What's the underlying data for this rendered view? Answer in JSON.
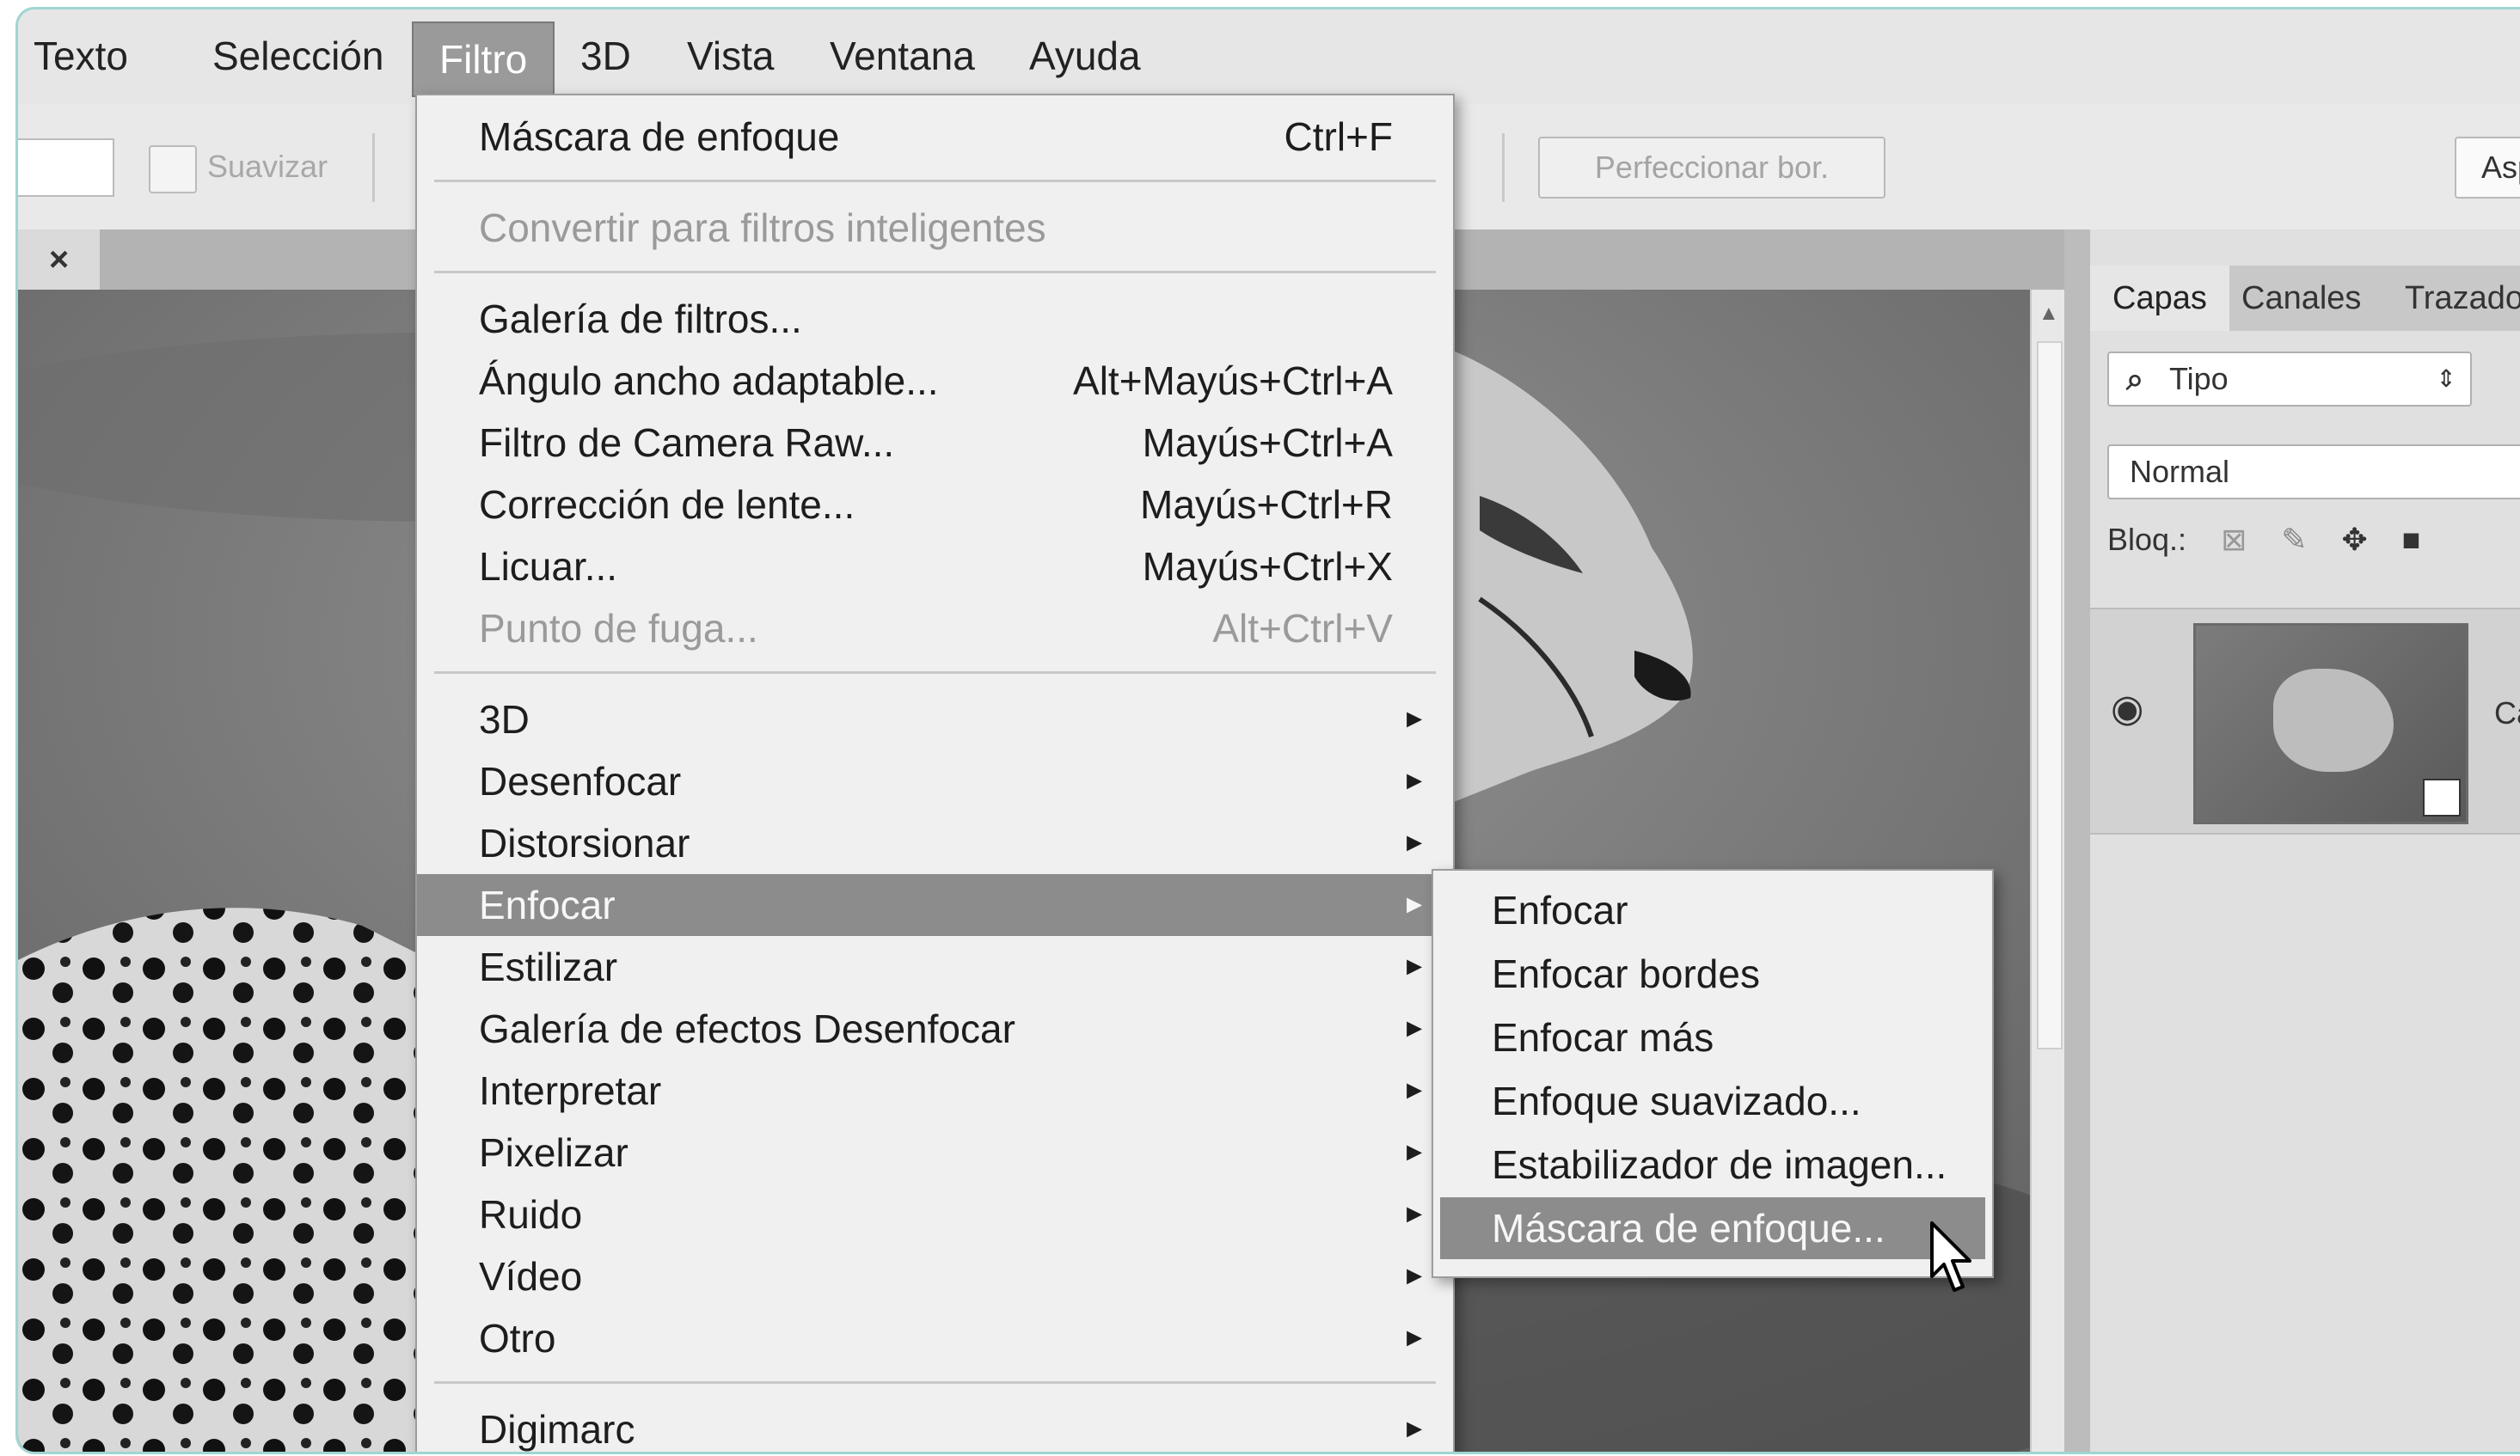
{
  "menubar": {
    "items": [
      "Texto",
      "Selección",
      "Filtro",
      "3D",
      "Vista",
      "Ventana",
      "Ayuda"
    ],
    "active": "Filtro"
  },
  "options": {
    "suavizar_label": "Suavizar",
    "refine_button": "Perfeccionar bor.",
    "truncated_button": "Asp"
  },
  "document": {
    "close_glyph": "×"
  },
  "filter_menu": {
    "items": [
      {
        "label": "Máscara de enfoque",
        "shortcut": "Ctrl+F",
        "state": "normal"
      },
      {
        "label": "Convertir para filtros inteligentes",
        "shortcut": "",
        "state": "disabled"
      },
      {
        "label": "Galería de filtros...",
        "shortcut": "",
        "state": "normal"
      },
      {
        "label": "Ángulo ancho adaptable...",
        "shortcut": "Alt+Mayús+Ctrl+A",
        "state": "normal"
      },
      {
        "label": "Filtro de Camera Raw...",
        "shortcut": "Mayús+Ctrl+A",
        "state": "normal"
      },
      {
        "label": "Corrección de lente...",
        "shortcut": "Mayús+Ctrl+R",
        "state": "normal"
      },
      {
        "label": "Licuar...",
        "shortcut": "Mayús+Ctrl+X",
        "state": "normal"
      },
      {
        "label": "Punto de fuga...",
        "shortcut": "Alt+Ctrl+V",
        "state": "disabled"
      },
      {
        "label": "3D",
        "submenu": true,
        "state": "normal"
      },
      {
        "label": "Desenfocar",
        "submenu": true,
        "state": "normal"
      },
      {
        "label": "Distorsionar",
        "submenu": true,
        "state": "normal"
      },
      {
        "label": "Enfocar",
        "submenu": true,
        "state": "highlighted"
      },
      {
        "label": "Estilizar",
        "submenu": true,
        "state": "normal"
      },
      {
        "label": "Galería de efectos Desenfocar",
        "submenu": true,
        "state": "normal"
      },
      {
        "label": "Interpretar",
        "submenu": true,
        "state": "normal"
      },
      {
        "label": "Pixelizar",
        "submenu": true,
        "state": "normal"
      },
      {
        "label": "Ruido",
        "submenu": true,
        "state": "normal"
      },
      {
        "label": "Vídeo",
        "submenu": true,
        "state": "normal"
      },
      {
        "label": "Otro",
        "submenu": true,
        "state": "normal"
      },
      {
        "label": "Digimarc",
        "submenu": true,
        "state": "normal"
      }
    ],
    "submenu_arrow": "►"
  },
  "enfocar_submenu": {
    "items": [
      {
        "label": "Enfocar",
        "state": "normal"
      },
      {
        "label": "Enfocar bordes",
        "state": "normal"
      },
      {
        "label": "Enfocar más",
        "state": "normal"
      },
      {
        "label": "Enfoque suavizado...",
        "state": "normal"
      },
      {
        "label": "Estabilizador de imagen...",
        "state": "normal"
      },
      {
        "label": "Máscara de enfoque...",
        "state": "highlighted"
      }
    ]
  },
  "layers_panel": {
    "tabs": [
      "Capas",
      "Canales",
      "Trazados"
    ],
    "active_tab": "Capas",
    "filter_select": "Tipo",
    "blend_mode": "Normal",
    "lock_label": "Bloq.:",
    "layer_name": "Ca"
  }
}
